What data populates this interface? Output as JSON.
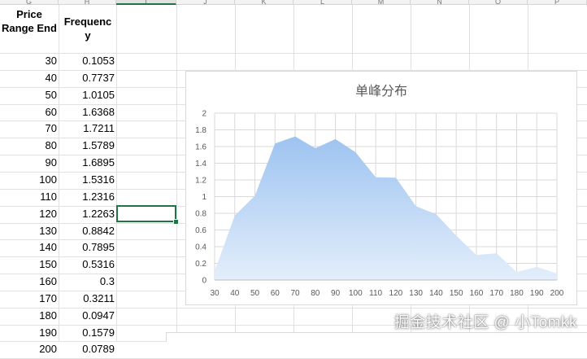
{
  "columns": [
    "G",
    "H",
    "I",
    "J",
    "K",
    "L",
    "M",
    "N",
    "O",
    "P"
  ],
  "headers": {
    "price": "Price Range End",
    "frequency": "Frequency"
  },
  "rows": [
    {
      "end": "30",
      "freq": "0.1053"
    },
    {
      "end": "40",
      "freq": "0.7737"
    },
    {
      "end": "50",
      "freq": "1.0105"
    },
    {
      "end": "60",
      "freq": "1.6368"
    },
    {
      "end": "70",
      "freq": "1.7211"
    },
    {
      "end": "80",
      "freq": "1.5789"
    },
    {
      "end": "90",
      "freq": "1.6895"
    },
    {
      "end": "100",
      "freq": "1.5316"
    },
    {
      "end": "110",
      "freq": "1.2316"
    },
    {
      "end": "120",
      "freq": "1.2263"
    },
    {
      "end": "130",
      "freq": "0.8842"
    },
    {
      "end": "140",
      "freq": "0.7895"
    },
    {
      "end": "150",
      "freq": "0.5316"
    },
    {
      "end": "160",
      "freq": "0.3"
    },
    {
      "end": "170",
      "freq": "0.3211"
    },
    {
      "end": "180",
      "freq": "0.0947"
    },
    {
      "end": "190",
      "freq": "0.1579"
    },
    {
      "end": "200",
      "freq": "0.0789"
    }
  ],
  "chart_data": {
    "type": "area",
    "title": "单峰分布",
    "x": [
      30,
      40,
      50,
      60,
      70,
      80,
      90,
      100,
      110,
      120,
      130,
      140,
      150,
      160,
      170,
      180,
      190,
      200
    ],
    "series": [
      {
        "values": [
          0.1053,
          0.7737,
          1.0105,
          1.6368,
          1.7211,
          1.5789,
          1.6895,
          1.5316,
          1.2316,
          1.2263,
          0.8842,
          0.7895,
          0.5316,
          0.3,
          0.3211,
          0.0947,
          0.1579,
          0.0789
        ]
      }
    ],
    "ylim": [
      0,
      2
    ],
    "yticks": [
      "0",
      "0.2",
      "0.4",
      "0.6",
      "0.8",
      "1",
      "1.2",
      "1.4",
      "1.6",
      "1.8",
      "2"
    ],
    "grid": true,
    "fill_color_top": "#9dc3f0",
    "fill_color_bottom": "#e3eefb"
  },
  "watermark": "掘金技术社区 @ 小Tomkk",
  "colors": {
    "selection": "#217346",
    "grid": "#e1e1e1"
  }
}
